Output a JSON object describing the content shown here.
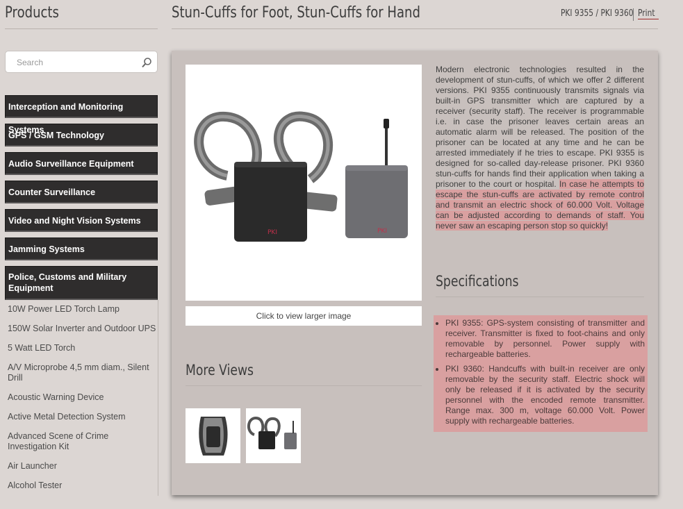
{
  "sidebar": {
    "title": "Products",
    "search_placeholder": "Search",
    "categories": [
      "Interception and Monitoring Systems",
      "GPS / GSM Technology",
      "Audio Surveillance Equipment",
      "Counter Surveillance",
      "Video and Night Vision Systems",
      "Jamming Systems",
      "Police, Customs and Military Equipment"
    ],
    "subcategories": [
      "10W Power LED Torch Lamp",
      "150W Solar Inverter and Outdoor UPS",
      "5 Watt LED Torch",
      "A/V Microprobe 4,5 mm diam., Silent Drill",
      "Acoustic Warning Device",
      "Active Metal Detection System",
      "Advanced Scene of Crime Investigation Kit",
      "Air Launcher",
      "Alcohol Tester"
    ]
  },
  "header": {
    "title": "Stun-Cuffs for Foot, Stun-Cuffs for Hand",
    "sku": "PKI 9355 / PKI 9360",
    "print_label": "Print"
  },
  "product": {
    "image_caption": "Click to view larger image",
    "more_views_title": "More Views",
    "description_plain": "Modern electronic technologies resulted in the development of stun-cuffs, of which we offer 2 different versions. PKI 9355 continuously transmits signals via built-in GPS transmitter which are captured by a receiver (security staff). The receiver is programmable i.e. in case the prisoner leaves certain areas an automatic alarm will be released. The position of the prisoner can be located at any time and he can be arrested immediately if he tries to escape. PKI 9355 is designed for so-called day-release prisoner. PKI 9360 stun-cuffs for hands find their application when taking a prisoner to the court or hospital.",
    "description_highlight": "In case he attempts to escape the stun-cuffs are activated by remote control and transmit an electric shock of 60.000 Volt. Voltage can be adjusted according to demands of staff. You never saw an escaping person stop so quickly!",
    "specifications_title": "Specifications",
    "specifications": [
      "PKI 9355: GPS-system consisting of transmitter and receiver. Transmitter is fixed to foot-chains and only removable by personnel. Power supply with rechargeable batteries.",
      "PKI 9360: Handcuffs with built-in receiver are only removable by the security staff. Electric shock will only be released if it is activated by the security personnel with the encoded remote transmitter. Range max. 300 m, voltage 60.000 Volt. Power supply with rechargeable batteries."
    ],
    "logo_text": "PKI"
  },
  "colors": {
    "background": "#dcd6d3",
    "panel": "#c8c0bd",
    "category_bg": "#2f2d2d",
    "highlight": "#d9a0a0",
    "accent": "#9c2b2b"
  }
}
